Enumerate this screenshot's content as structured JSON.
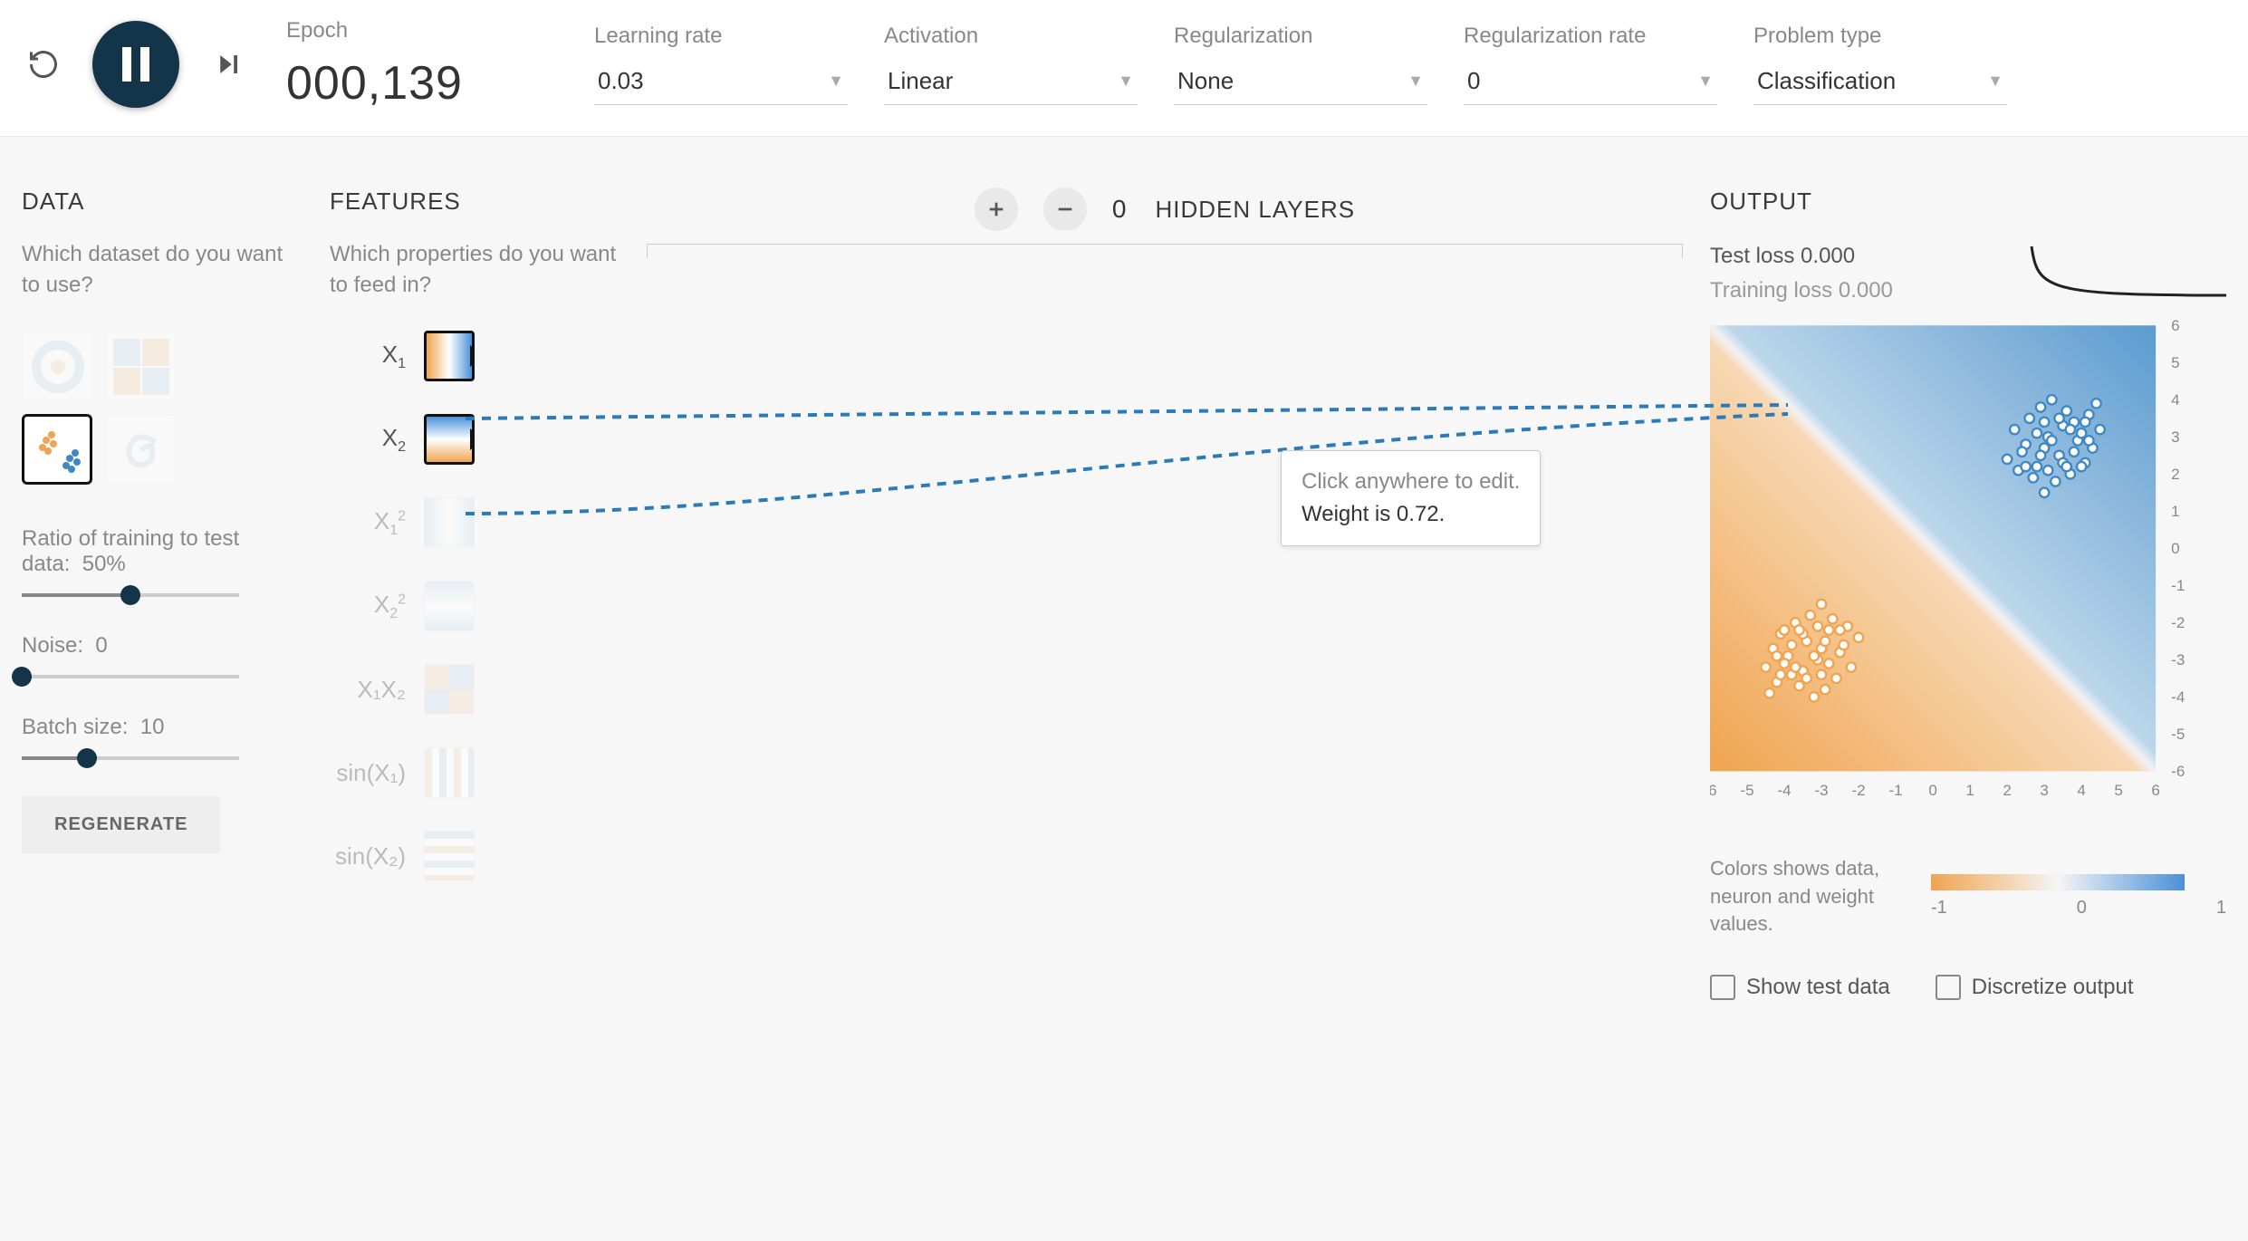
{
  "controls": {
    "epoch_label": "Epoch",
    "epoch_value": "000,139",
    "learning_rate_label": "Learning rate",
    "learning_rate_value": "0.03",
    "activation_label": "Activation",
    "activation_value": "Linear",
    "regularization_label": "Regularization",
    "regularization_value": "None",
    "regularization_rate_label": "Regularization rate",
    "regularization_rate_value": "0",
    "problem_type_label": "Problem type",
    "problem_type_value": "Classification"
  },
  "data_panel": {
    "title": "DATA",
    "subtitle": "Which dataset do you want to use?",
    "ratio_label": "Ratio of training to test data:",
    "ratio_value": "50%",
    "noise_label": "Noise:",
    "noise_value": "0",
    "batch_label": "Batch size:",
    "batch_value": "10",
    "regenerate_label": "REGENERATE"
  },
  "features_panel": {
    "title": "FEATURES",
    "subtitle": "Which properties do you want to feed in?",
    "items": [
      {
        "label": "X",
        "sub": "1",
        "sup": "",
        "active": true
      },
      {
        "label": "X",
        "sub": "2",
        "sup": "",
        "active": true
      },
      {
        "label": "X",
        "sub": "1",
        "sup": "2",
        "active": false
      },
      {
        "label": "X",
        "sub": "2",
        "sup": "2",
        "active": false
      },
      {
        "label": "X₁X₂",
        "sub": "",
        "sup": "",
        "active": false
      },
      {
        "label": "sin(X₁)",
        "sub": "",
        "sup": "",
        "active": false
      },
      {
        "label": "sin(X₂)",
        "sub": "",
        "sup": "",
        "active": false
      }
    ]
  },
  "network": {
    "hidden_layers_count": "0",
    "hidden_layers_label": "HIDDEN LAYERS",
    "tooltip_click": "Click anywhere to edit.",
    "tooltip_weight": "Weight is 0.72."
  },
  "output": {
    "title": "OUTPUT",
    "test_loss_label": "Test loss",
    "test_loss_value": "0.000",
    "training_loss_label": "Training loss",
    "training_loss_value": "0.000",
    "legend_text": "Colors shows data, neuron and weight values.",
    "legend_min": "-1",
    "legend_mid": "0",
    "legend_max": "1",
    "show_test_label": "Show test data",
    "discretize_label": "Discretize output",
    "axis_ticks": [
      "-6",
      "-5",
      "-4",
      "-3",
      "-2",
      "-1",
      "0",
      "1",
      "2",
      "3",
      "4",
      "5",
      "6"
    ]
  },
  "chart_data": {
    "type": "scatter",
    "title": "",
    "xlabel": "",
    "ylabel": "",
    "xlim": [
      -6,
      6
    ],
    "ylim": [
      -6,
      6
    ],
    "decision_boundary": "diagonal from bottom-left to top-right; upper-right region blue, lower-left region orange",
    "series": [
      {
        "name": "class-blue",
        "color": "#3f88c5",
        "points": [
          [
            2.0,
            2.4
          ],
          [
            2.3,
            2.1
          ],
          [
            2.5,
            2.8
          ],
          [
            2.8,
            2.2
          ],
          [
            3.0,
            2.7
          ],
          [
            3.1,
            3.0
          ],
          [
            3.4,
            2.5
          ],
          [
            3.5,
            3.3
          ],
          [
            3.7,
            2.0
          ],
          [
            3.8,
            3.4
          ],
          [
            3.9,
            2.9
          ],
          [
            4.0,
            3.1
          ],
          [
            4.1,
            2.3
          ],
          [
            4.2,
            3.6
          ],
          [
            4.3,
            2.7
          ],
          [
            4.4,
            3.9
          ],
          [
            2.2,
            3.2
          ],
          [
            2.6,
            3.5
          ],
          [
            2.9,
            3.8
          ],
          [
            3.2,
            4.0
          ],
          [
            3.6,
            3.7
          ],
          [
            3.3,
            1.8
          ],
          [
            3.0,
            1.5
          ],
          [
            2.7,
            1.9
          ],
          [
            4.0,
            2.2
          ],
          [
            4.2,
            2.9
          ],
          [
            4.5,
            3.2
          ],
          [
            2.4,
            2.6
          ],
          [
            2.8,
            3.1
          ],
          [
            3.5,
            2.3
          ],
          [
            3.8,
            2.6
          ],
          [
            3.1,
            2.1
          ],
          [
            3.4,
            3.5
          ],
          [
            3.6,
            2.2
          ],
          [
            2.9,
            2.5
          ],
          [
            3.2,
            2.9
          ],
          [
            3.7,
            3.2
          ],
          [
            4.1,
            3.4
          ],
          [
            3.0,
            3.4
          ],
          [
            2.5,
            2.2
          ]
        ]
      },
      {
        "name": "class-orange",
        "color": "#f0a44f",
        "points": [
          [
            -2.0,
            -2.4
          ],
          [
            -2.3,
            -2.1
          ],
          [
            -2.5,
            -2.8
          ],
          [
            -2.8,
            -2.2
          ],
          [
            -3.0,
            -2.7
          ],
          [
            -3.1,
            -3.0
          ],
          [
            -3.4,
            -2.5
          ],
          [
            -3.5,
            -3.3
          ],
          [
            -3.7,
            -2.0
          ],
          [
            -3.8,
            -3.4
          ],
          [
            -3.9,
            -2.9
          ],
          [
            -4.0,
            -3.1
          ],
          [
            -4.1,
            -2.3
          ],
          [
            -4.2,
            -3.6
          ],
          [
            -4.3,
            -2.7
          ],
          [
            -4.4,
            -3.9
          ],
          [
            -2.2,
            -3.2
          ],
          [
            -2.6,
            -3.5
          ],
          [
            -2.9,
            -3.8
          ],
          [
            -3.2,
            -4.0
          ],
          [
            -3.6,
            -3.7
          ],
          [
            -3.3,
            -1.8
          ],
          [
            -3.0,
            -1.5
          ],
          [
            -2.7,
            -1.9
          ],
          [
            -4.0,
            -2.2
          ],
          [
            -4.2,
            -2.9
          ],
          [
            -4.5,
            -3.2
          ],
          [
            -2.4,
            -2.6
          ],
          [
            -2.8,
            -3.1
          ],
          [
            -3.5,
            -2.3
          ],
          [
            -3.8,
            -2.6
          ],
          [
            -3.1,
            -2.1
          ],
          [
            -3.4,
            -3.5
          ],
          [
            -3.6,
            -2.2
          ],
          [
            -2.9,
            -2.5
          ],
          [
            -3.2,
            -2.9
          ],
          [
            -3.7,
            -3.2
          ],
          [
            -4.1,
            -3.4
          ],
          [
            -3.0,
            -3.4
          ],
          [
            -2.5,
            -2.2
          ]
        ]
      }
    ]
  }
}
